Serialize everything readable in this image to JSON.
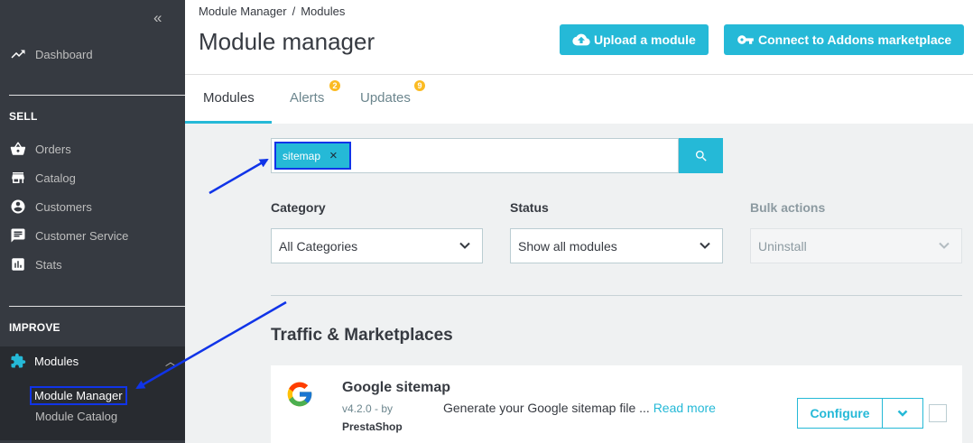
{
  "sidebar": {
    "collapse_glyph": "«",
    "dashboard": "Dashboard",
    "sections": {
      "sell": "SELL",
      "improve": "IMPROVE"
    },
    "sell_items": [
      {
        "label": "Orders",
        "icon": "basket-icon"
      },
      {
        "label": "Catalog",
        "icon": "store-icon"
      },
      {
        "label": "Customers",
        "icon": "account-icon"
      },
      {
        "label": "Customer Service",
        "icon": "chat-icon"
      },
      {
        "label": "Stats",
        "icon": "stats-icon"
      }
    ],
    "modules": {
      "label": "Modules",
      "icon": "puzzle-icon"
    },
    "sub_items": [
      "Module Manager",
      "Module Catalog"
    ]
  },
  "breadcrumb": [
    "Module Manager",
    "Modules"
  ],
  "breadcrumb_sep": "/",
  "title": "Module manager",
  "buttons": {
    "upload": "Upload a module",
    "connect": "Connect to Addons marketplace"
  },
  "tabs": [
    {
      "label": "Modules",
      "active": true
    },
    {
      "label": "Alerts",
      "badge": "2"
    },
    {
      "label": "Updates",
      "badge": "9"
    }
  ],
  "search": {
    "tag": "sitemap",
    "tag_close": "×"
  },
  "filters": {
    "category": {
      "label": "Category",
      "value": "All Categories"
    },
    "status": {
      "label": "Status",
      "value": "Show all modules"
    },
    "bulk": {
      "label": "Bulk actions",
      "value": "Uninstall"
    }
  },
  "section_title": "Traffic & Marketplaces",
  "module": {
    "name": "Google sitemap",
    "version": "v4.2.0 - by",
    "author": "PrestaShop",
    "description": "Generate your Google sitemap file ...",
    "read_more": "Read more",
    "configure": "Configure"
  },
  "colors": {
    "accent": "#25b9d7",
    "sidebar_bg": "#363a41",
    "annotation": "#1034e8",
    "badge": "#fbbb22"
  }
}
